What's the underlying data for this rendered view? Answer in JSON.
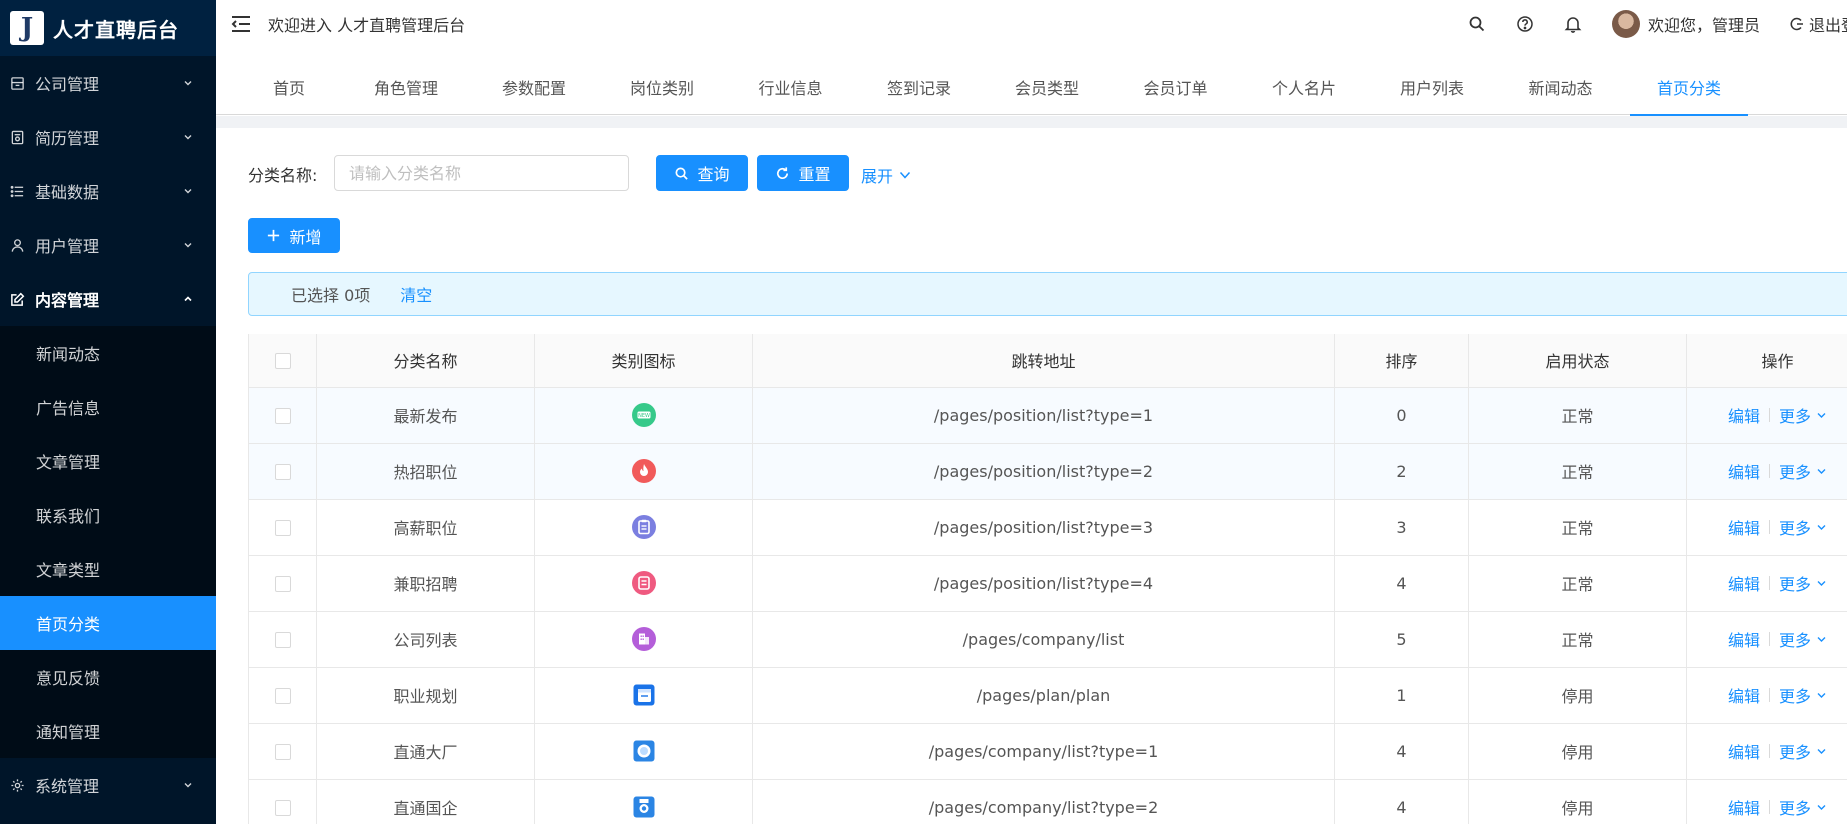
{
  "app": {
    "logo_letter": "J",
    "title": "人才直聘后台"
  },
  "header": {
    "welcome": "欢迎进入 人才直聘管理后台",
    "user_text": "欢迎您，管理员",
    "logout": "退出登"
  },
  "sidebar": {
    "groups": [
      {
        "label": "公司管理",
        "icon": "building-icon",
        "open": false
      },
      {
        "label": "简历管理",
        "icon": "resume-icon",
        "open": false
      },
      {
        "label": "基础数据",
        "icon": "list-icon",
        "open": false
      },
      {
        "label": "用户管理",
        "icon": "user-icon",
        "open": false
      },
      {
        "label": "内容管理",
        "icon": "edit-icon",
        "open": true
      },
      {
        "label": "系统管理",
        "icon": "gear-icon",
        "open": false
      }
    ],
    "content_items": [
      "新闻动态",
      "广告信息",
      "文章管理",
      "联系我们",
      "文章类型",
      "首页分类",
      "意见反馈",
      "通知管理"
    ],
    "active_item": "首页分类"
  },
  "tabs": [
    "首页",
    "角色管理",
    "参数配置",
    "岗位类别",
    "行业信息",
    "签到记录",
    "会员类型",
    "会员订单",
    "个人名片",
    "用户列表",
    "新闻动态",
    "首页分类"
  ],
  "active_tab": "首页分类",
  "search": {
    "label": "分类名称:",
    "placeholder": "请输入分类名称",
    "query_label": "查询",
    "reset_label": "重置",
    "expand_label": "展开",
    "add_label": "新增"
  },
  "alert": {
    "selected_text": "已选择 0项",
    "clear_label": "清空"
  },
  "table": {
    "columns": [
      "分类名称",
      "类别图标",
      "跳转地址",
      "排序",
      "启用状态",
      "操作"
    ],
    "edit_label": "编辑",
    "more_label": "更多",
    "rows": [
      {
        "name": "最新发布",
        "icon": "new-badge-icon",
        "icon_color": "#36c98a",
        "url": "/pages/position/list?type=1",
        "sort": "0",
        "status": "正常"
      },
      {
        "name": "热招职位",
        "icon": "flame-icon",
        "icon_color": "#f15a5a",
        "url": "/pages/position/list?type=2",
        "sort": "2",
        "status": "正常"
      },
      {
        "name": "高薪职位",
        "icon": "clipboard-icon",
        "icon_color": "#7b7fe0",
        "url": "/pages/position/list?type=3",
        "sort": "3",
        "status": "正常"
      },
      {
        "name": "兼职招聘",
        "icon": "document-icon",
        "icon_color": "#ef5a80",
        "url": "/pages/position/list?type=4",
        "sort": "4",
        "status": "正常"
      },
      {
        "name": "公司列表",
        "icon": "company-icon",
        "icon_color": "#b45ed9",
        "url": "/pages/company/list",
        "sort": "5",
        "status": "正常"
      },
      {
        "name": "职业规划",
        "icon": "calendar-icon",
        "icon_color": "#1a73e8",
        "url": "/pages/plan/plan",
        "sort": "1",
        "status": "停用"
      },
      {
        "name": "直通大厂",
        "icon": "globe-icon",
        "icon_color": "#2b85e4",
        "url": "/pages/company/list?type=1",
        "sort": "4",
        "status": "停用"
      },
      {
        "name": "直通国企",
        "icon": "medal-icon",
        "icon_color": "#2b85e4",
        "url": "/pages/company/list?type=2",
        "sort": "4",
        "status": "停用"
      }
    ]
  },
  "colors": {
    "primary": "#1890ff",
    "sidebar_bg": "#001529",
    "sidebar_active": "#1890ff"
  }
}
